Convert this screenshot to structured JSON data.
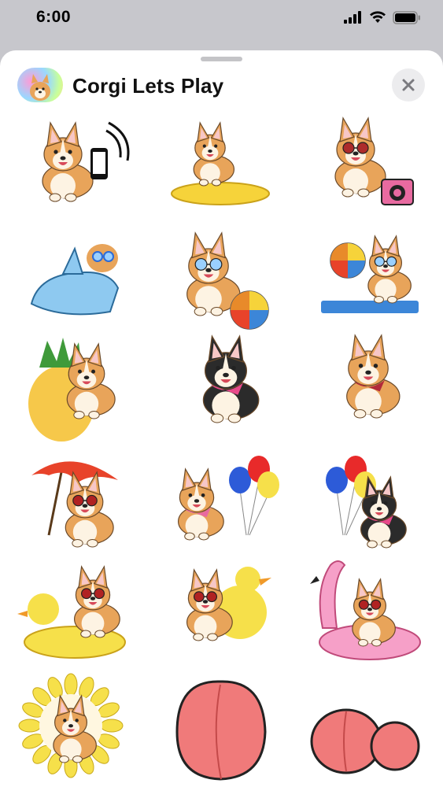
{
  "status_bar": {
    "time": "6:00",
    "signal_icon": "cellular-signal-icon",
    "wifi_icon": "wifi-icon",
    "battery_icon": "battery-icon"
  },
  "header": {
    "app_title": "Corgi Lets Play",
    "app_icon": "corgi-app-icon",
    "close_icon": "close-icon"
  },
  "stickers": [
    {
      "name": "corgi-phone-sticker",
      "prop": "phone"
    },
    {
      "name": "corgi-float-sticker",
      "prop": "float-yellow"
    },
    {
      "name": "corgi-camera-sticker",
      "prop": "camera"
    },
    {
      "name": "corgi-shark-costume-sticker",
      "prop": "shark"
    },
    {
      "name": "corgi-goggles-ball-sticker",
      "prop": "beachball"
    },
    {
      "name": "corgi-yoga-ball-sticker",
      "prop": "beachball-mat"
    },
    {
      "name": "corgi-pineapple-sticker",
      "prop": "pineapple"
    },
    {
      "name": "tricolor-corgi-pink-scarf-sticker",
      "prop": "tricolor"
    },
    {
      "name": "corgi-red-scarf-sticker",
      "prop": "red-scarf"
    },
    {
      "name": "corgi-umbrella-sticker",
      "prop": "umbrella"
    },
    {
      "name": "corgi-balloons-sticker",
      "prop": "balloons"
    },
    {
      "name": "tricolor-corgi-balloons-sticker",
      "prop": "balloons-tricolor"
    },
    {
      "name": "corgi-duck-float-sticker",
      "prop": "duck-float"
    },
    {
      "name": "corgi-rubber-duck-sticker",
      "prop": "duck"
    },
    {
      "name": "corgi-flamingo-float-sticker",
      "prop": "flamingo"
    },
    {
      "name": "corgi-sunflower-sticker",
      "prop": "sunflower"
    },
    {
      "name": "peach-sticker",
      "prop": "peach"
    },
    {
      "name": "two-peaches-sticker",
      "prop": "peaches"
    }
  ],
  "colors": {
    "corgi_orange": "#e8a45a",
    "corgi_cream": "#fdf3e3",
    "sheet_bg": "#ffffff",
    "backdrop": "#c7c7cc"
  }
}
